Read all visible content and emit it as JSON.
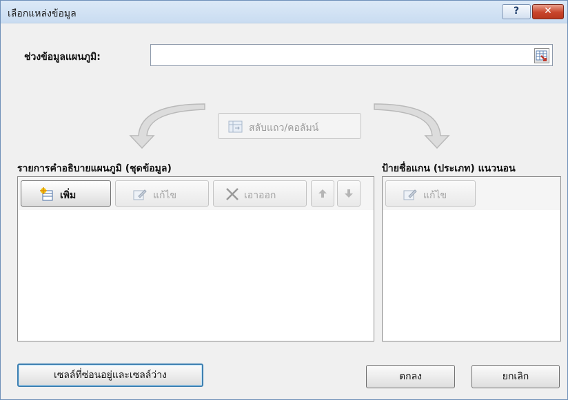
{
  "window": {
    "title": "เลือกแหล่งข้อมูล",
    "help_icon": "question-mark-icon",
    "close_icon": "close-icon",
    "close_color": "#c8452c"
  },
  "chart_range": {
    "label": "ช่วงข้อมูลแผนภูมิ:",
    "value": "",
    "picker_icon": "range-selector-icon"
  },
  "switch_row_column": {
    "label": "สลับแถว/คอลัมน์",
    "icon": "switch-row-column-icon"
  },
  "legend_entries": {
    "heading": "รายการคำอธิบายแผนภูมิ (ชุดข้อมูล)",
    "add_label": "เพิ่ม",
    "edit_label": "แก้ไข",
    "remove_label": "เอาออก",
    "move_up_icon": "arrow-up-icon",
    "move_down_icon": "arrow-down-icon",
    "items": []
  },
  "axis_labels": {
    "heading": "ป้ายชื่อแกน (ประเภท) แนวนอน",
    "edit_label": "แก้ไข",
    "items": []
  },
  "footer": {
    "hidden_empty_cells_label": "เซลล์ที่ซ่อนอยู่และเซลล์ว่าง",
    "ok_label": "ตกลง",
    "cancel_label": "ยกเลิก"
  }
}
